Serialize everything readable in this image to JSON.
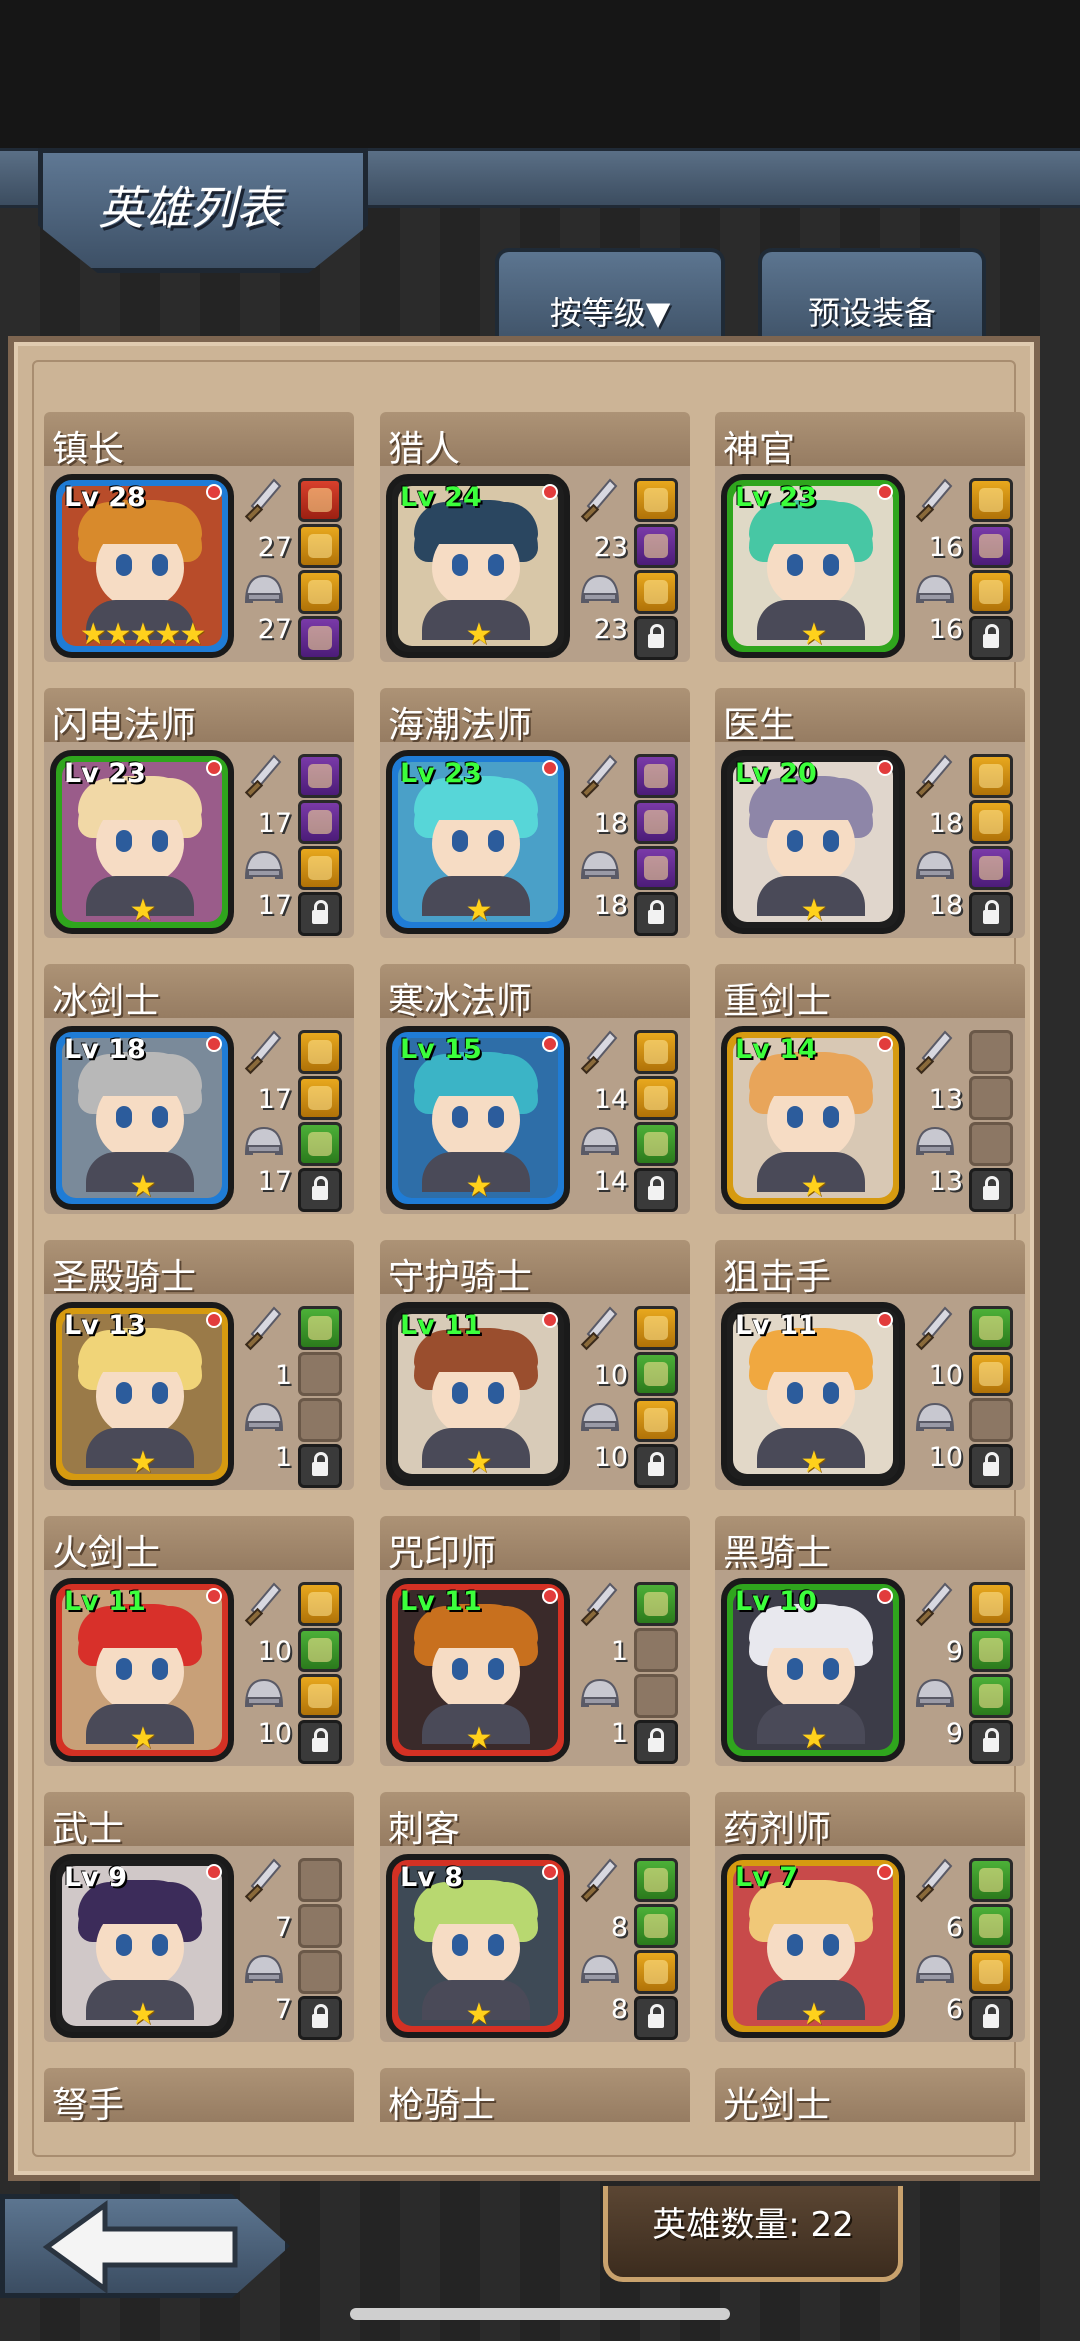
{
  "screen": {
    "title": "英雄列表",
    "sort_tab_label": "按等级▼",
    "preset_tab_label": "预设装备",
    "hero_count_label": "英雄数量: 22"
  },
  "colors": {
    "level_green": "#3cff3c",
    "level_white": "#ffffff",
    "star_gold": "#ffd11c",
    "panel_parchment": "#ccb496"
  },
  "heroes": [
    {
      "name": "镇长",
      "level": "Lv 28",
      "level_color": "#ffffff",
      "frame": "blue",
      "stars": "★★★★★",
      "attack": "27",
      "defense": "27",
      "slots": [
        "equip-red",
        "equip-gold",
        "equip-gold",
        "equip-purple"
      ],
      "hair": "#d88a2c",
      "bg": "#b84c2a"
    },
    {
      "name": "猎人",
      "level": "Lv 24",
      "level_color": "#3cff3c",
      "frame": "dark",
      "stars": "★",
      "attack": "23",
      "defense": "23",
      "slots": [
        "equip-gold",
        "equip-purple",
        "equip-gold",
        "lock"
      ],
      "hair": "#2a4660",
      "bg": "#d8c7a8"
    },
    {
      "name": "神官",
      "level": "Lv 23",
      "level_color": "#3cff3c",
      "frame": "green",
      "stars": "★",
      "attack": "16",
      "defense": "16",
      "slots": [
        "equip-gold",
        "equip-purple",
        "equip-gold",
        "lock"
      ],
      "hair": "#47c7a4",
      "bg": "#dfd9c6"
    },
    {
      "name": "闪电法师",
      "level": "Lv 23",
      "level_color": "#ffffff",
      "frame": "green",
      "stars": "★",
      "attack": "17",
      "defense": "17",
      "slots": [
        "equip-purple",
        "equip-purple",
        "equip-gold",
        "lock"
      ],
      "hair": "#f1d8a6",
      "bg": "#9a5c8a"
    },
    {
      "name": "海潮法师",
      "level": "Lv 23",
      "level_color": "#3cff3c",
      "frame": "blue",
      "stars": "★",
      "attack": "18",
      "defense": "18",
      "slots": [
        "equip-purple",
        "equip-purple",
        "equip-purple",
        "lock"
      ],
      "hair": "#57d6d8",
      "bg": "#4aa0c8"
    },
    {
      "name": "医生",
      "level": "Lv 20",
      "level_color": "#3cff3c",
      "frame": "dark",
      "stars": "★",
      "attack": "18",
      "defense": "18",
      "slots": [
        "equip-gold",
        "equip-gold",
        "equip-purple",
        "lock"
      ],
      "hair": "#8e86a8",
      "bg": "#e0d6cc"
    },
    {
      "name": "冰剑士",
      "level": "Lv 18",
      "level_color": "#ffffff",
      "frame": "blue",
      "stars": "★",
      "attack": "17",
      "defense": "17",
      "slots": [
        "equip-gold",
        "equip-gold",
        "equip-green",
        "lock"
      ],
      "hair": "#b8b8b8",
      "bg": "#7a8a9a"
    },
    {
      "name": "寒冰法师",
      "level": "Lv 15",
      "level_color": "#3cff3c",
      "frame": "blue",
      "stars": "★",
      "attack": "14",
      "defense": "14",
      "slots": [
        "equip-gold",
        "equip-gold",
        "equip-green",
        "lock"
      ],
      "hair": "#3bb4c6",
      "bg": "#2e6ea8"
    },
    {
      "name": "重剑士",
      "level": "Lv 14",
      "level_color": "#3cff3c",
      "frame": "gold",
      "stars": "★",
      "attack": "13",
      "defense": "13",
      "slots": [
        "empty",
        "empty",
        "empty",
        "lock"
      ],
      "hair": "#e8a55a",
      "bg": "#d8c8b4"
    },
    {
      "name": "圣殿骑士",
      "level": "Lv 13",
      "level_color": "#ffffff",
      "frame": "gold",
      "stars": "★",
      "attack": "1",
      "defense": "1",
      "slots": [
        "equip-green",
        "empty",
        "empty",
        "lock"
      ],
      "hair": "#f0d478",
      "bg": "#9a7a48"
    },
    {
      "name": "守护骑士",
      "level": "Lv 11",
      "level_color": "#3cff3c",
      "frame": "dark",
      "stars": "★",
      "attack": "10",
      "defense": "10",
      "slots": [
        "equip-gold",
        "equip-green",
        "equip-gold",
        "lock"
      ],
      "hair": "#9a4e2e",
      "bg": "#d8cbb8"
    },
    {
      "name": "狙击手",
      "level": "Lv 11",
      "level_color": "#ffffff",
      "frame": "dark",
      "stars": "★",
      "attack": "10",
      "defense": "10",
      "slots": [
        "equip-green",
        "equip-gold",
        "empty",
        "lock"
      ],
      "hair": "#f0a840",
      "bg": "#e2d8c8"
    },
    {
      "name": "火剑士",
      "level": "Lv 11",
      "level_color": "#3cff3c",
      "frame": "red",
      "stars": "★",
      "attack": "10",
      "defense": "10",
      "slots": [
        "equip-gold",
        "equip-green",
        "equip-gold",
        "lock"
      ],
      "hair": "#d8302a",
      "bg": "#c8a078"
    },
    {
      "name": "咒印师",
      "level": "Lv 11",
      "level_color": "#3cff3c",
      "frame": "red",
      "stars": "★",
      "attack": "1",
      "defense": "1",
      "slots": [
        "equip-green",
        "empty",
        "empty",
        "lock"
      ],
      "hair": "#c8701e",
      "bg": "#3a2a2a"
    },
    {
      "name": "黑骑士",
      "level": "Lv 10",
      "level_color": "#3cff3c",
      "frame": "green",
      "stars": "★",
      "attack": "9",
      "defense": "9",
      "slots": [
        "equip-gold",
        "equip-green",
        "equip-green",
        "lock"
      ],
      "hair": "#e8e8ee",
      "bg": "#3c3c48"
    },
    {
      "name": "武士",
      "level": "Lv 9",
      "level_color": "#ffffff",
      "frame": "dark",
      "stars": "★",
      "attack": "7",
      "defense": "7",
      "slots": [
        "empty",
        "empty",
        "empty",
        "lock"
      ],
      "hair": "#3c2c5a",
      "bg": "#d0c8c8"
    },
    {
      "name": "刺客",
      "level": "Lv 8",
      "level_color": "#ffffff",
      "frame": "red",
      "stars": "★",
      "attack": "8",
      "defense": "8",
      "slots": [
        "equip-green",
        "equip-green",
        "equip-gold",
        "lock"
      ],
      "hair": "#b8d870",
      "bg": "#3e4a56"
    },
    {
      "name": "药剂师",
      "level": "Lv 7",
      "level_color": "#3cff3c",
      "frame": "gold",
      "stars": "★",
      "attack": "6",
      "defense": "6",
      "slots": [
        "equip-green",
        "equip-green",
        "equip-gold",
        "lock"
      ],
      "hair": "#f0c878",
      "bg": "#c84a4a"
    },
    {
      "name": "弩手"
    },
    {
      "name": "枪骑士"
    },
    {
      "name": "光剑士"
    }
  ]
}
